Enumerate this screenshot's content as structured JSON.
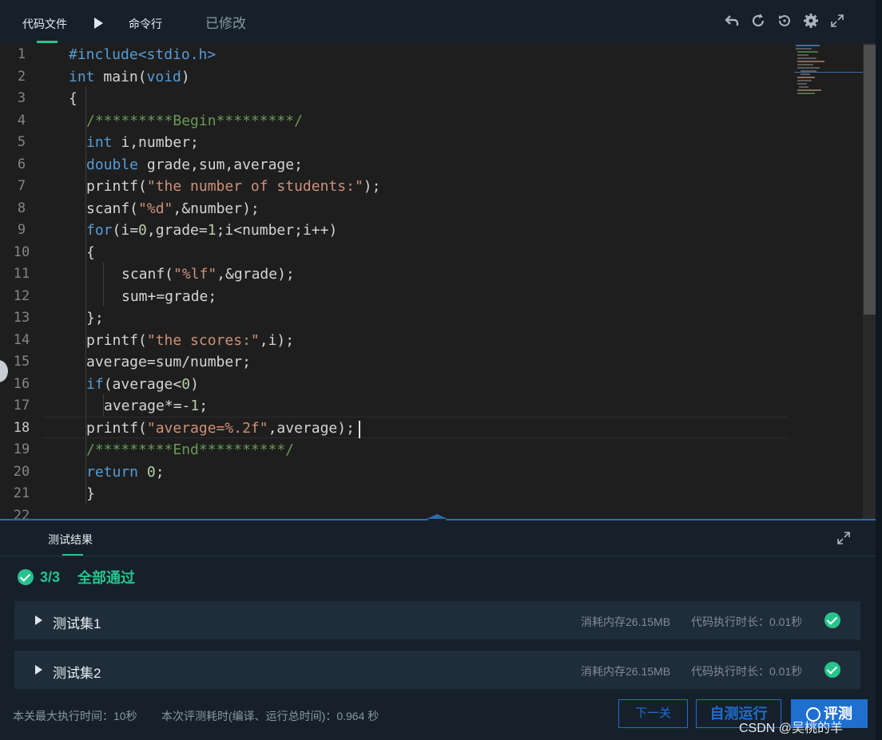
{
  "header": {
    "tab_code": "代码文件",
    "tab_cli": "命令行",
    "status": "已修改",
    "icons": [
      "undo-icon",
      "refresh-icon",
      "history-icon",
      "settings-gear-icon",
      "fullscreen-icon"
    ]
  },
  "editor": {
    "line_numbers": [
      "1",
      "2",
      "3",
      "4",
      "5",
      "6",
      "7",
      "8",
      "9",
      "10",
      "11",
      "12",
      "13",
      "14",
      "15",
      "16",
      "17",
      "18",
      "19",
      "20",
      "21",
      "22"
    ],
    "lines": [
      "#include<stdio.h>",
      "int main(void)",
      "{",
      "/*********Begin*********/",
      "int i,number;",
      "double grade,sum,average;",
      "printf(\"the number of students:\");",
      "scanf(\"%d\",&number);",
      "for(i=0,grade=1;i<number;i++)",
      "{",
      "scanf(\"%lf\",&grade);",
      "sum+=grade;",
      "};",
      "printf(\"the scores:\",i);",
      "average=sum/number;",
      "if(average<0)",
      "average*=-1;",
      "printf(\"average=%.2f\",average);",
      "/*********End**********/",
      "return 0;",
      "}",
      ""
    ],
    "active_line": "18"
  },
  "results": {
    "tab_label": "测试结果",
    "summary_count": "3/3",
    "summary_text": "全部通过",
    "cases": [
      {
        "name": "测试集1",
        "memory": "消耗内存26.15MB",
        "time": "代码执行时长：0.01秒"
      },
      {
        "name": "测试集2",
        "memory": "消耗内存26.15MB",
        "time": "代码执行时长：0.01秒"
      }
    ]
  },
  "footer": {
    "max_time": "本关最大执行时间：10秒",
    "eval_time": "本次评测耗时(编译、运行总时间)：0.964 秒",
    "next_btn": "下一关",
    "run_btn": "自测运行",
    "eval_btn": "评测"
  },
  "watermark": "CSDN @吴桃的羊",
  "colors": {
    "accent": "#27c38c",
    "primary": "#1f6fd1",
    "keyword": "#569cd6",
    "string": "#ce9178",
    "comment": "#6a9955"
  }
}
